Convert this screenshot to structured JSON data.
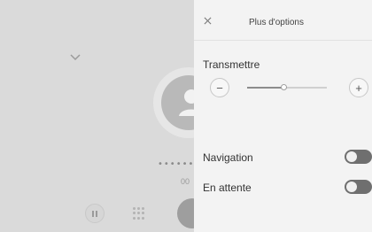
{
  "colors": {
    "panel_bg": "#f3f3f3",
    "call_bg": "#dadada",
    "toggle_on": "#6f6f6f"
  },
  "call_screen": {
    "masked_number": "••••••",
    "timer": "00"
  },
  "panel": {
    "title": "Plus d'options",
    "close_icon": "×",
    "volume": {
      "label": "Transmettre",
      "minus": "−",
      "plus": "+",
      "level": 0.45
    },
    "toggles": [
      {
        "label": "Navigation",
        "on": true
      },
      {
        "label": "En attente",
        "on": true
      }
    ]
  }
}
